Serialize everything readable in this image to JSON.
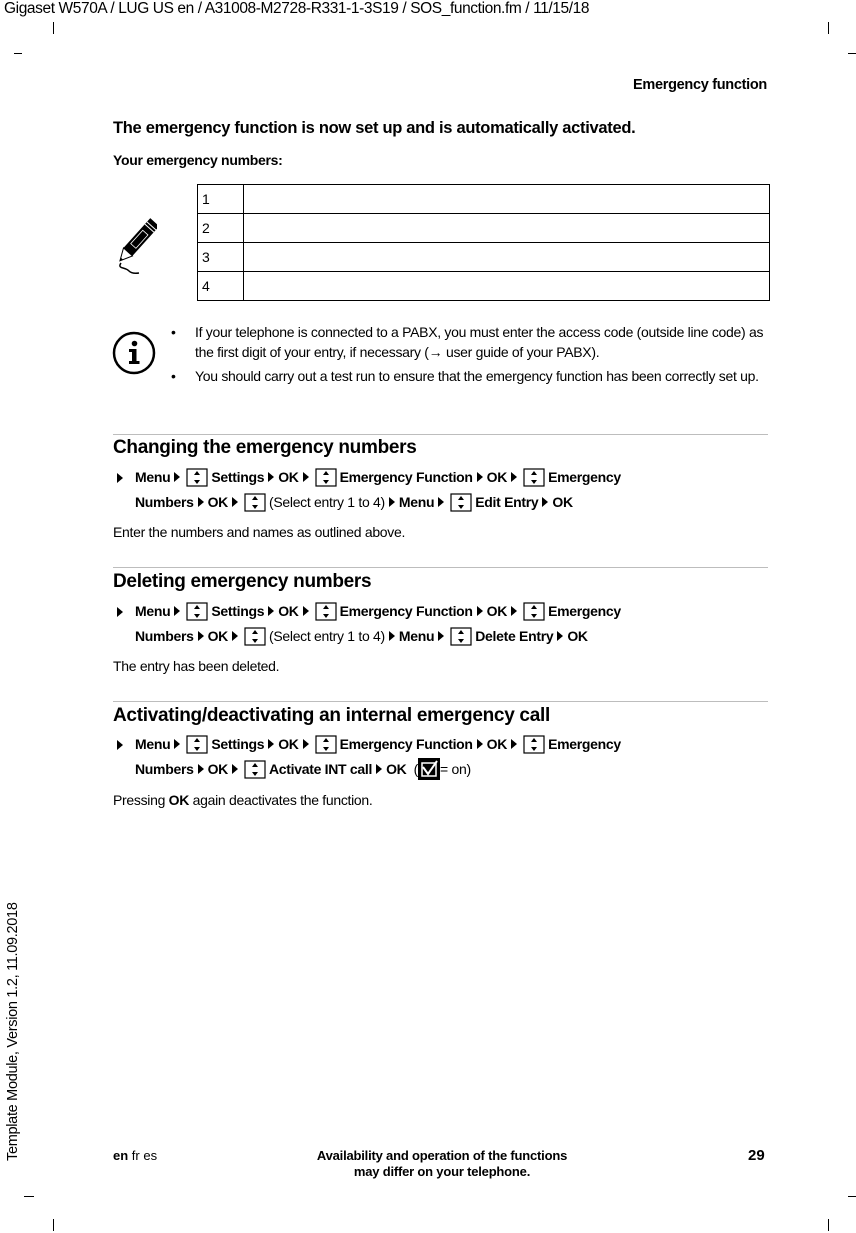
{
  "header": {
    "file_info": "Gigaset W570A / LUG US en / A31008-M2728-R331-1-3S19 / SOS_function.fm / 11/15/18",
    "running_head": "Emergency function"
  },
  "intro": {
    "title": "The emergency function is now set up and is automatically activated.",
    "numbers_label": "Your emergency numbers:",
    "entries": [
      {
        "index": "1",
        "value": ""
      },
      {
        "index": "2",
        "value": ""
      },
      {
        "index": "3",
        "value": ""
      },
      {
        "index": "4",
        "value": ""
      }
    ],
    "icon": "pencil-icon"
  },
  "info": {
    "icon": "info-icon",
    "bullets": [
      {
        "text_before": "If your telephone is connected to a PABX, you must enter the access code (outside line code) as the first digit of your entry, if necessary (",
        "arrow": "→",
        "text_after": " user guide of your PABX)."
      },
      {
        "text_before": "You should carry out a test run to ensure that the emergency function has been correctly set up.",
        "arrow": "",
        "text_after": ""
      }
    ]
  },
  "sections": [
    {
      "title": "Changing the emergency numbers",
      "steps": {
        "menu": "Menu",
        "settings": "Settings",
        "ok": "OK",
        "emergency_function": "Emergency Function",
        "emergency_numbers_1": "Emergency",
        "emergency_numbers_2": "Numbers",
        "select": "(Select entry 1 to 4)",
        "action": "Edit Entry"
      },
      "note": "Enter the numbers and names as outlined above."
    },
    {
      "title": "Deleting emergency numbers",
      "steps": {
        "menu": "Menu",
        "settings": "Settings",
        "ok": "OK",
        "emergency_function": "Emergency Function",
        "emergency_numbers_1": "Emergency",
        "emergency_numbers_2": "Numbers",
        "select": "(Select entry 1 to 4)",
        "action": "Delete Entry"
      },
      "note": "The entry has been deleted."
    },
    {
      "title": "Activating/deactivating an internal emergency call",
      "steps": {
        "menu": "Menu",
        "settings": "Settings",
        "ok": "OK",
        "emergency_function": "Emergency Function",
        "emergency_numbers_1": "Emergency",
        "emergency_numbers_2": "Numbers",
        "action": "Activate INT call",
        "legend": "= on"
      },
      "note_prefix": "Pressing ",
      "note_bold": "OK",
      "note_suffix": " again deactivates the function."
    }
  ],
  "footer": {
    "lang_active": "en",
    "lang_others": " fr es",
    "disclaimer_1": "Availability and operation of the functions",
    "disclaimer_2": "may differ on your telephone.",
    "page_number": "29",
    "side_text": "Template Module, Version 1.2, 11.09.2018"
  }
}
